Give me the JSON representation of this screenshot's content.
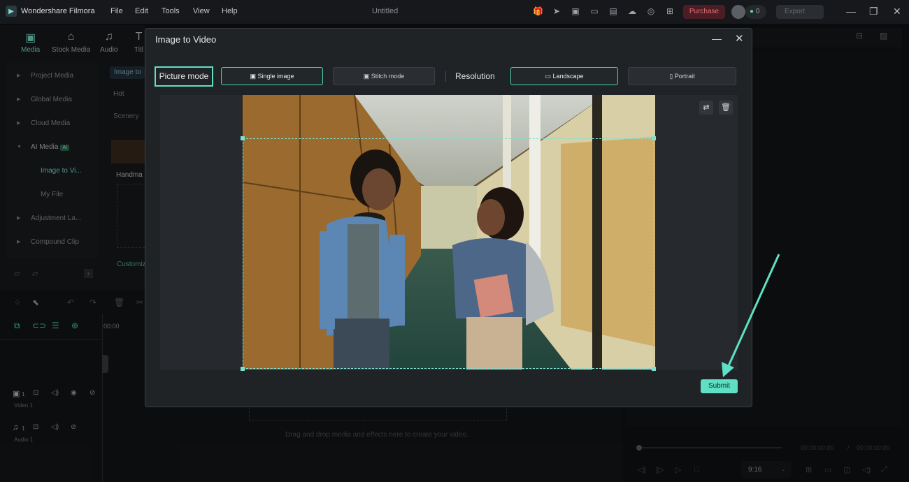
{
  "app": {
    "name": "Wondershare Filmora",
    "menu": [
      "File",
      "Edit",
      "Tools",
      "View",
      "Help"
    ],
    "project_title": "Untitled",
    "purchase_label": "Purchase",
    "credits": "0",
    "export_label": "Export"
  },
  "top_tabs": [
    "Media",
    "Stock Media",
    "Audio",
    "Titl"
  ],
  "sidebar": {
    "items": [
      {
        "label": "Project Media"
      },
      {
        "label": "Global Media"
      },
      {
        "label": "Cloud Media"
      },
      {
        "label": "AI Media",
        "badge": "AI"
      },
      {
        "label": "Image to Vi..."
      },
      {
        "label": "My File"
      },
      {
        "label": "Adjustment La..."
      },
      {
        "label": "Compound Clip"
      }
    ]
  },
  "media_panel": {
    "chip": "Image to",
    "hot_label": "Hot",
    "scenery_label": "Scenery",
    "card_label": "Handma",
    "customize_label": "Customiz"
  },
  "timeline": {
    "ruler_start": "00:00",
    "video_track": "Video 1",
    "audio_track": "Audio 1",
    "track_counts": [
      "1",
      "1"
    ],
    "drop_hint": "Drag and drop media and effects here to create your video."
  },
  "player": {
    "time_current": "00:00:00:00",
    "time_total": "00:00:00:00",
    "ratio": "9:16"
  },
  "dialog": {
    "title": "Image to Video",
    "picture_mode_label": "Picture mode",
    "single_image_label": "Single image",
    "stitch_mode_label": "Stitch mode",
    "resolution_label": "Resolution",
    "landscape_label": "Landscape",
    "portrait_label": "Portrait",
    "submit_label": "Submit",
    "selected_mode": "Single image",
    "selected_resolution": "Landscape"
  },
  "colors": {
    "accent": "#5fe0c4",
    "purchase_bg": "#4a1e24",
    "dialog_bg": "#202326"
  }
}
